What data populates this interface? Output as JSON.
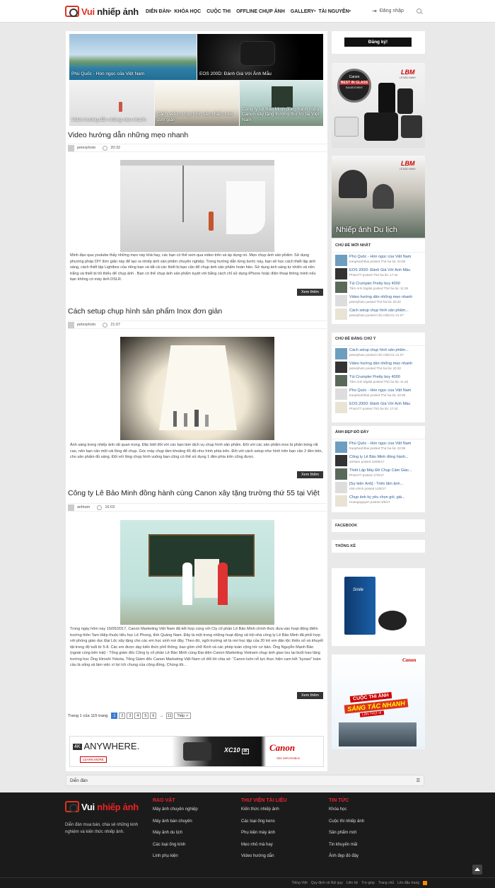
{
  "header": {
    "logo_text_1": "Vui",
    "logo_text_2": "nhiếp ảnh",
    "nav": [
      "DIỄN ĐÀN",
      "KHÓA HỌC",
      "CUỘC THI",
      "OFFLINE CHỤP ẢNH",
      "GALLERY",
      "TÀI NGUYÊN"
    ],
    "login_label": "Đăng nhập"
  },
  "slider": {
    "captions": [
      "Phú Quốc - Hòn ngọc của Việt Nam",
      "EOS 200D: Đánh Giá Với Ảnh Mẫu",
      "Video hướng dẫn những mẹo nhanh",
      "Cách setup chụp hình sản phẩm Inox đơn giản",
      "Công ty Lê Bảo Minh đồng hành cùng Canon xây tặng trường thứ 55 tại Việt Nam"
    ]
  },
  "articles": [
    {
      "title": "Video hướng dẫn những mẹo nhanh",
      "author": "peterphoto",
      "time": "20:32",
      "excerpt": "Minh đạo qua youtube thấy những mẹo này khá hay, các bạn có thể xem qua video trên và áp dụng nó. Mẹo chụp ảnh sản phẩm: Sử dụng phương pháp DIY đơn giản này để tạo ra nhiếp ảnh sản phẩm chuyên nghiệp. Trong hướng dẫn từng bước này, bạn sẽ học cách thiết lập ánh sáng, cách thiết lập Lightbox của riêng bạn và tất cả các thiết bị bạn cần để chụp ảnh sản phẩm hoàn hảo. Sử dụng ánh sáng tự nhiên và nền trắng và thiết bị tối thiểu để chụp ảnh . Bạn có thể chụp ảnh sản phẩm tuyệt vời bằng cách chỉ sử dụng iPhone hoặc điện thoại thông minh nếu bạn không có máy ảnh DSLR.",
      "more": "Xem thêm"
    },
    {
      "title": "Cách setup chụp hình sản phẩm Inox đơn giản",
      "author": "peterphoto",
      "time": "21:07",
      "excerpt": "Ánh sáng trong nhiếp ảnh rất quan trọng. Đặc biệt đối với các bạn làm dịch vụ chụp hình sản phẩm. Đối với các sản phẩm inox bị phản bóng rất cao, nên bạn cần một cái lồng để chụp. Góc máy chụp tầm khoảng 45 độ như hình phía trên. Đối với cách setup như hình trên bạn cần 2 đèn bên, cho sản phẩm đủ sáng. Đối với lồng chụp hình vuông bạn cũng có thể sử dụng 1 đèn phía trên cũng được.",
      "more": "Xem thêm"
    },
    {
      "title": "Công ty Lê Bảo Minh đồng hành cùng Canon xây tặng trường thứ 55 tại Việt",
      "author": "anhtam",
      "time": "16:03",
      "excerpt": "Trong ngày hôm nay 15/05/2017, Canon Marketing Việt Nam đã kết hợp cùng với Cty cổ phần Lê Bảo Minh chính thức đưa vào hoạt động điểm trường thôn Tam Hiệp thuộc tiểu học Lê Phong, tỉnh Quảng Nam. Đây là một trong những hoạt động xã hội nhà công ty Lê Bảo Minh đã phối hợp với phòng giáo dục Đại Lộc xây tặng cho các em học sinh nơi đây. Theo đó, ngôi trường sẽ là nơi học tập của 20 trẻ em dân tộc thiểu số và khuyết tật trong độ tuổi từ 5-8. Các em được dạy kiến thức phổ thông, bao gồm chữ Kinh và các phép toán cộng trừ cơ bản. Ông Nguyễn Mạnh Bảo (ngoài cùng bên trái) - Tổng giám đốc Công ty cổ phần Lê Bảo Minh cùng Đại diện Canon Marketing Vietnam chụp ảnh giao lưu tại buổi trao tặng trường học Ông Hiroshi Yokota, Tổng Giám đốc Canon Marketing Việt Nam cô đối lời chia sẻ: “Canon luôn nỗ lực thực hiện cam kết “kyosei” toàn cầu là sống và làm việc vì lợi ích chung của cộng đồng. Chúng tôi...",
      "more": "Xem thêm"
    }
  ],
  "pagination": {
    "label": "Trang 1 của 115 trang",
    "pages": [
      "1",
      "2",
      "3",
      "4",
      "5",
      "6"
    ],
    "ellipsis": "→",
    "last": "11",
    "next": "Tiếp >"
  },
  "ad_banner": {
    "badge": "4K",
    "headline": "ANYWHERE.",
    "learn_more": "LEARN MORE",
    "model": "XC10",
    "model_badge": "4K",
    "brand": "Canon",
    "tagline": "SEE IMPOSSIBLE"
  },
  "breadcrumb": "Diễn đàn",
  "sidebar": {
    "register_label": "Đăng ký!",
    "ad1": {
      "badge_brand": "Canon",
      "badge_title": "BEST IN GLASS",
      "badge_sub": "SALES EVENT",
      "dealer": "LÊ BẢO MINH"
    },
    "ad2": {
      "caption": "Nhiếp ảnh Du lịch",
      "dealer": "LÊ BẢO MINH"
    },
    "widgets": [
      {
        "title": "CHỦ ĐỀ MỚI NHẤT",
        "items": [
          {
            "title": "Phú Quốc - Hòn ngọc của Việt Nam",
            "sub": "tranphanhthai posted Thứ ba lúc 23:08"
          },
          {
            "title": "EOS 200D: Đánh Giá Với Ảnh Mẫu",
            "sub": "PhotoTT posted Thứ ba lúc 17:42"
          },
          {
            "title": "Túi Crumpler Pretty boy 4000",
            "sub": "Tâm Anh Digital posted Thứ ba lúc 11:26"
          },
          {
            "title": "Video hướng dẫn những mẹo nhanh",
            "sub": "peterphoto posted Thứ ba lúc 20:32"
          },
          {
            "title": "Cách setup chụp hình sản phẩm...",
            "sub": "peterphoto posted Chủ nhật lúc 21:07"
          }
        ]
      },
      {
        "title": "CHỦ ĐỀ ĐÁNG CHÚ Ý",
        "items": [
          {
            "title": "Cách setup chụp hình sản phẩm...",
            "sub": "peterphoto posted Chủ nhật lúc 21:07"
          },
          {
            "title": "Video hướng dẫn những mẹo nhanh",
            "sub": "peterphoto posted Thứ ba lúc 20:32"
          },
          {
            "title": "Túi Crumpler Pretty boy 4000",
            "sub": "Tâm Anh Digital posted Thứ ba lúc 11:26"
          },
          {
            "title": "Phú Quốc - Hòn ngọc của Việt Nam",
            "sub": "tranphanhthai posted Thứ ba lúc 23:08"
          },
          {
            "title": "EOS 200D: Đánh Giá Với Ảnh Mẫu",
            "sub": "PhotoTT posted Thứ ba lúc 17:42"
          }
        ]
      },
      {
        "title": "ẢNH ĐẸP ĐỒ ĐẦY",
        "items": [
          {
            "title": "Phú Quốc - Hòn ngọc của Việt Nam",
            "sub": "tranphanhthai posted Thứ ba lúc 23:08"
          },
          {
            "title": "Công ty Lê Bảo Minh đồng hành...",
            "sub": "anhtam posted 16/05/17"
          },
          {
            "title": "Thiết Lập Máy Để Chụp Cảm Giác...",
            "sub": "PhotoTT posted 17/5/17"
          },
          {
            "title": "[Sự kiện Ảnh] - Triển lãm ảnh...",
            "sub": "nhin.nhnh posted 12/5/17"
          },
          {
            "title": "Chụp ảnh kỷ yếu chọn gói, giá...",
            "sub": "Hoangnguyen posted 3/8/17"
          }
        ]
      }
    ],
    "facebook_title": "FACEBOOK",
    "stats_title": "THỐNG KÊ",
    "ad3": {
      "product": "Smile"
    },
    "ad4": {
      "brand": "Canon",
      "line1": "CUỘC THI ẢNH",
      "line2": "SÁNG TÁC NHANH",
      "line3": "LẦN THỨ III"
    }
  },
  "footer": {
    "about": "Diễn đàn mua bán, chia sẻ những kinh nghiệm và kiến thức nhiếp ảnh.",
    "columns": [
      {
        "title": "RAO VẶT",
        "links": [
          "Máy ảnh chuyên nghiệp",
          "Máy ảnh bán chuyên",
          "Máy ảnh du lịch",
          "Các loại ống kính",
          "Linh phụ kiện"
        ]
      },
      {
        "title": "THƯ VIỆN TÀI LIỆU",
        "links": [
          "Kiến thức nhiếp ảnh",
          "Các loại ống kens",
          "Phụ kiện máy ảnh",
          "Mẹo nhỏ mà hay",
          "Video hướng dẫn"
        ]
      },
      {
        "title": "TIN TỨC",
        "links": [
          "Khóa học",
          "Cuộc thi nhiếp ảnh",
          "Sản phẩm mới",
          "Tin khuyến mãi",
          "Ảnh đẹp đó đây"
        ]
      }
    ],
    "bottom_links": [
      "Tiếng Việt",
      "Quy định và Nội quy",
      "Liên hệ",
      "Trợ giúp",
      "Trang chủ",
      "Lên đầu trang"
    ]
  },
  "colors": {
    "accent": "#d32f2f",
    "link": "#2a5c9a",
    "footer_bg": "#1b1b1b",
    "footer_heading": "#e22a2a"
  }
}
